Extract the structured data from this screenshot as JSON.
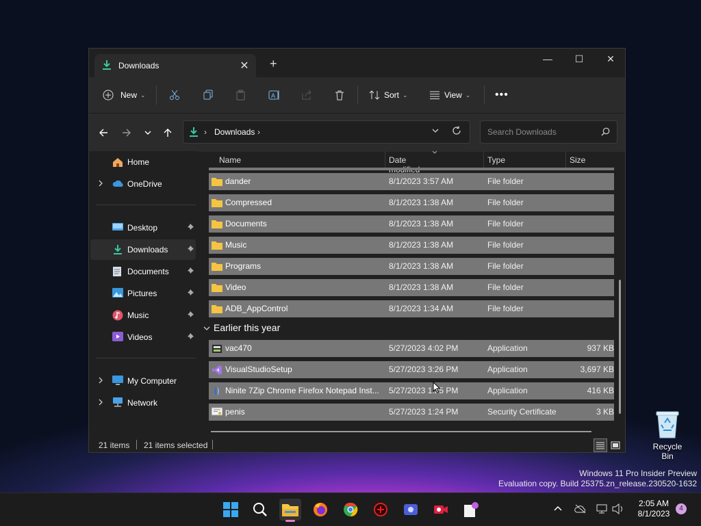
{
  "desktop": {
    "recycle_bin_label": "Recycle Bin",
    "watermark_line1": "Windows 11 Pro Insider Preview",
    "watermark_line2": "Evaluation copy. Build 25375.zn_release.230520-1632"
  },
  "window": {
    "tab_title": "Downloads",
    "toolbar": {
      "new_label": "New",
      "sort_label": "Sort",
      "view_label": "View"
    },
    "address": {
      "location": "Downloads",
      "search_placeholder": "Search Downloads"
    },
    "sidebar": {
      "items": [
        {
          "label": "Home",
          "icon": "home-icon"
        },
        {
          "label": "OneDrive",
          "icon": "cloud-icon"
        },
        {
          "label": "Desktop",
          "icon": "desktop-folder-icon",
          "pinned": true
        },
        {
          "label": "Downloads",
          "icon": "download-icon",
          "pinned": true,
          "selected": true
        },
        {
          "label": "Documents",
          "icon": "documents-icon",
          "pinned": true
        },
        {
          "label": "Pictures",
          "icon": "pictures-icon",
          "pinned": true
        },
        {
          "label": "Music",
          "icon": "music-icon",
          "pinned": true
        },
        {
          "label": "Videos",
          "icon": "videos-icon",
          "pinned": true
        },
        {
          "label": "My Computer",
          "icon": "computer-icon"
        },
        {
          "label": "Network",
          "icon": "network-icon"
        }
      ]
    },
    "columns": {
      "name": "Name",
      "date": "Date modified",
      "type": "Type",
      "size": "Size"
    },
    "rows": [
      {
        "name": "dander",
        "date": "8/1/2023 3:57 AM",
        "type": "File folder",
        "size": "",
        "icon": "folder-icon"
      },
      {
        "name": "Compressed",
        "date": "8/1/2023 1:38 AM",
        "type": "File folder",
        "size": "",
        "icon": "folder-icon"
      },
      {
        "name": "Documents",
        "date": "8/1/2023 1:38 AM",
        "type": "File folder",
        "size": "",
        "icon": "folder-icon"
      },
      {
        "name": "Music",
        "date": "8/1/2023 1:38 AM",
        "type": "File folder",
        "size": "",
        "icon": "folder-icon"
      },
      {
        "name": "Programs",
        "date": "8/1/2023 1:38 AM",
        "type": "File folder",
        "size": "",
        "icon": "folder-icon"
      },
      {
        "name": "Video",
        "date": "8/1/2023 1:38 AM",
        "type": "File folder",
        "size": "",
        "icon": "folder-icon"
      },
      {
        "name": "ADB_AppControl",
        "date": "8/1/2023 1:34 AM",
        "type": "File folder",
        "size": "",
        "icon": "folder-icon"
      }
    ],
    "group_label": "Earlier this year",
    "rows_earlier": [
      {
        "name": "vac470",
        "date": "5/27/2023 4:02 PM",
        "type": "Application",
        "size": "937 KB",
        "icon": "installer-icon"
      },
      {
        "name": "VisualStudioSetup",
        "date": "5/27/2023 3:26 PM",
        "type": "Application",
        "size": "3,697 KB",
        "icon": "visual-studio-icon"
      },
      {
        "name": "Ninite 7Zip Chrome Firefox Notepad Inst...",
        "date": "5/27/2023 1:25 PM",
        "type": "Application",
        "size": "416 KB",
        "icon": "ninite-icon"
      },
      {
        "name": "penis",
        "date": "5/27/2023 1:24 PM",
        "type": "Security Certificate",
        "size": "3 KB",
        "icon": "certificate-icon"
      }
    ],
    "status": {
      "items": "21 items",
      "selected": "21 items selected"
    }
  },
  "taskbar": {
    "apps": [
      "start-icon",
      "search-icon",
      "file-explorer-icon",
      "firefox-icon",
      "chrome-icon",
      "app-red-icon",
      "app-blue-icon",
      "camera-app-icon",
      "notepad-icon"
    ],
    "time": "2:05 AM",
    "date": "8/1/2023",
    "notifications": "4"
  },
  "colors": {
    "accent_download": "#3cc7a0",
    "folder": "#f5c542",
    "row_selected": "#777777"
  }
}
